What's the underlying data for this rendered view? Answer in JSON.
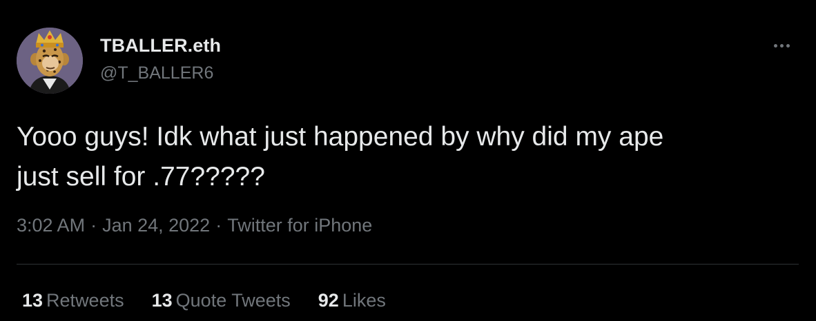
{
  "author": {
    "display_name": "TBALLER.eth",
    "handle": "@T_BALLER6",
    "avatar_icon": "ape-avatar-icon"
  },
  "tweet": {
    "text_line1": "Yooo guys! Idk what just happened by why did my ape",
    "text_line2": "just sell for .77?????"
  },
  "meta": {
    "time": "3:02 AM",
    "separator": "·",
    "date": "Jan 24, 2022",
    "source": "Twitter for iPhone"
  },
  "stats": {
    "retweets_count": "13",
    "retweets_label": "Retweets",
    "quotes_count": "13",
    "quotes_label": "Quote Tweets",
    "likes_count": "92",
    "likes_label": "Likes"
  },
  "colors": {
    "background": "#000000",
    "primary_text": "#e7e9ea",
    "secondary_text": "#71767b",
    "divider": "#2f3336"
  }
}
